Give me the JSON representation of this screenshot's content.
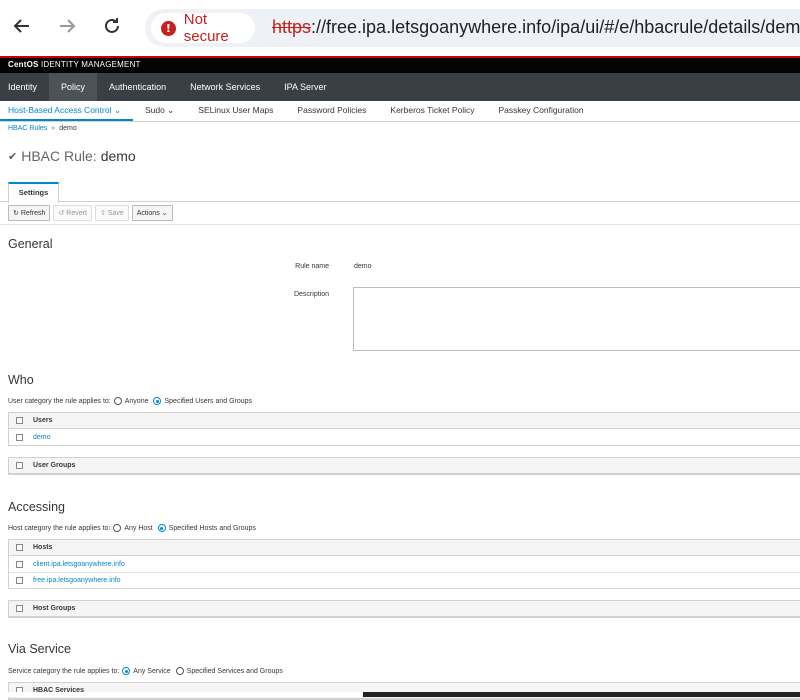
{
  "browser": {
    "security_label": "Not secure",
    "url_proto": "https",
    "url_rest": "://free.ipa.letsgoanywhere.info/ipa/ui/#/e/hbacrule/details/demo"
  },
  "brand": {
    "bold": "CentOS",
    "rest": " IDENTITY MANAGEMENT"
  },
  "top_nav": [
    "Identity",
    "Policy",
    "Authentication",
    "Network Services",
    "IPA Server"
  ],
  "sub_nav": [
    "Host-Based Access Control ⌄",
    "Sudo ⌄",
    "SELinux User Maps",
    "Password Policies",
    "Kerberos Ticket Policy",
    "Passkey Configuration"
  ],
  "breadcrumb": {
    "parent": "HBAC Rules",
    "sep": "»",
    "current": "demo"
  },
  "title": {
    "label": "HBAC Rule:",
    "name": "demo"
  },
  "tab": "Settings",
  "toolbar": {
    "refresh": "Refresh",
    "revert": "Revert",
    "save": "Save",
    "actions": "Actions ⌄"
  },
  "general": {
    "title": "General",
    "rule_name_label": "Rule name",
    "rule_name_value": "demo",
    "description_label": "Description"
  },
  "who": {
    "title": "Who",
    "category_label": "User category the rule applies to:",
    "opt_any": "Anyone",
    "opt_specified": "Specified Users and Groups",
    "users_header": "Users",
    "users": [
      "demo"
    ],
    "groups_header": "User Groups"
  },
  "accessing": {
    "title": "Accessing",
    "category_label": "Host category the rule applies to:",
    "opt_any": "Any Host",
    "opt_specified": "Specified Hosts and Groups",
    "hosts_header": "Hosts",
    "hosts": [
      "client.ipa.letsgoanywhere.info",
      "free.ipa.letsgoanywhere.info"
    ],
    "groups_header": "Host Groups"
  },
  "service": {
    "title": "Via Service",
    "category_label": "Service category the rule applies to:",
    "opt_any": "Any Service",
    "opt_specified": "Specified Services and Groups",
    "services_header": "HBAC Services"
  }
}
